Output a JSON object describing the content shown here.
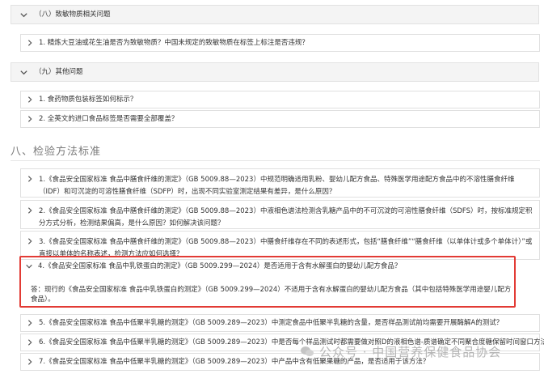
{
  "sections": {
    "s8": {
      "title": "（八）致敏物质相关问题",
      "items": [
        "1. 精炼大豆油或花生油是否为致敏物质？中国未规定的致敏物质在标签上标注是否违规？"
      ]
    },
    "s9": {
      "title": "（九）其他问题",
      "items": [
        "1. 食药物质包装标签如何标示？",
        "2. 全英文的进口食品标签是否需要全部覆盖？"
      ]
    }
  },
  "chapter": {
    "title": "八、检验方法标准"
  },
  "methods": [
    "1.《食品安全国家标准 食品中膳食纤维的测定》（GB 5009.88—2023）中规范明确适用乳粉、婴幼儿配方食品、特殊医学用途配方食品中的不溶性膳食纤维（IDF）和可沉淀的可溶性膳食纤维（SDFP）时，出现不同实验室测定结果有差异，是什么原因？",
    "2.《食品安全国家标准 食品中膳食纤维的测定》（GB 5009.88—2023）中液相色谱法检测含乳糖产品中的不可沉淀的可溶性膳食纤维（SDFS）时，按标准规定积分方式分析，检测结果偏高，是什么原因？如何解决该问题？",
    "3.《食品安全国家标准 食品中膳食纤维的测定》（GB 5009.88—2023）中膳食纤维存在不同的表述形式，包括“膳食纤维”“膳食纤维（以单体计或多个单体计）”或直接以单体的名称表述，检测方法应如何选择？",
    "4.《食品安全国家标准 食品中乳铁蛋白的测定》（GB 5009.299—2024）是否适用于含有水解蛋白的婴幼儿配方食品？",
    "5.《食品安全国家标准 食品中低聚半乳糖的测定》（GB 5009.289—2023）中测定食品中低聚半乳糖的含量，是否样品测试前均需要开展酶解A的测试？",
    "6.《食品安全国家标准 食品中低聚半乳糖的测定》（GB 5009.289—2023）中是否每个样品测试时都需要做对照D的液相色谱-质谱确定不同聚合度糖保留时间窗口方法？",
    "7.《食品安全国家标准 食品中低聚半乳糖的测定》（GB 5009.289—2023）中产品中含有低聚果糖的产品，是否适用于该方法？"
  ],
  "answer": "答：现行的《食品安全国家标准 食品中乳铁蛋白的测定》（GB 5009.299—2024）不适用于含有水解蛋白的婴幼儿配方食品（其中包括特殊医学用途婴儿配方食品）。",
  "watermark": {
    "text": "公众号 · 中国营养保健食品协会",
    "icon": "wechat-icon"
  }
}
